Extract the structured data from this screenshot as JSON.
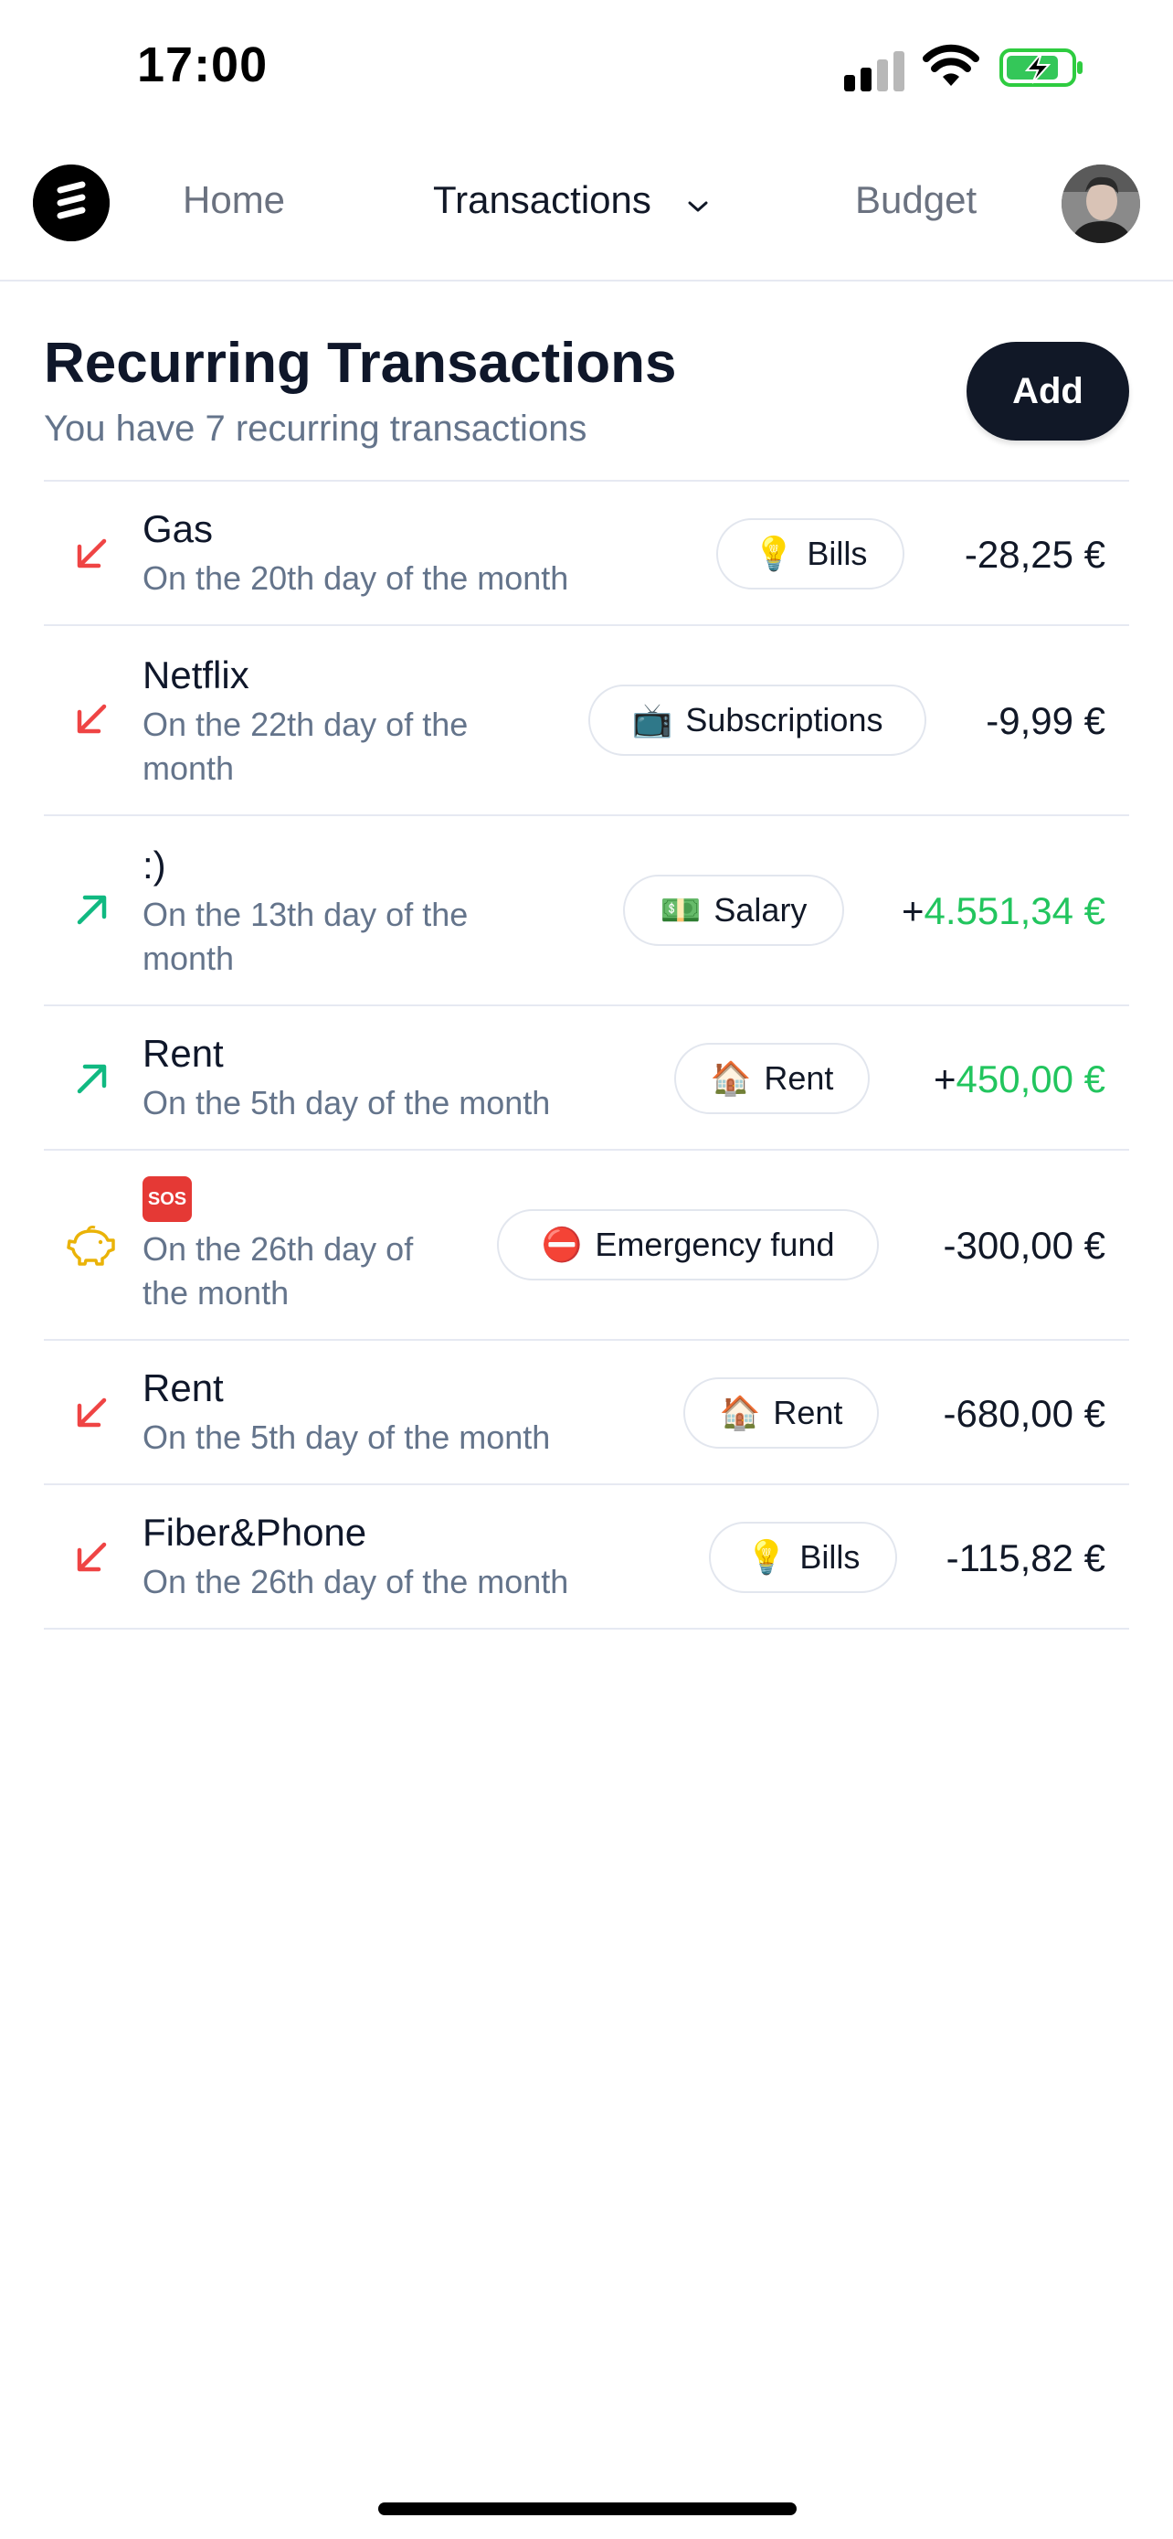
{
  "status_bar": {
    "time": "17:00"
  },
  "nav": {
    "home": "Home",
    "transactions": "Transactions",
    "budget": "Budget"
  },
  "header": {
    "title": "Recurring Transactions",
    "subtitle": "You have 7 recurring transactions",
    "add_label": "Add"
  },
  "colors": {
    "expense_arrow": "#ef4444",
    "income_arrow": "#10b981",
    "savings_icon": "#eab308",
    "positive_amount": "#22c55e",
    "button_bg": "#111827"
  },
  "transactions": [
    {
      "direction": "expense",
      "icon": "arrow-down-left-icon",
      "name": "Gas",
      "description": "On the 20th day of the month",
      "category_emoji": "💡",
      "category": "Bills",
      "amount": "-28,25 €"
    },
    {
      "direction": "expense",
      "icon": "arrow-down-left-icon",
      "name": "Netflix",
      "description": "On the 22th day of the month",
      "category_emoji": "📺",
      "category": "Subscriptions",
      "amount": "-9,99 €"
    },
    {
      "direction": "income",
      "icon": "arrow-up-right-icon",
      "name": ":)",
      "description": "On the 13th day of the month",
      "category_emoji": "💵",
      "category": "Salary",
      "amount_sign": "+",
      "amount_value": "4.551,34 €"
    },
    {
      "direction": "income",
      "icon": "arrow-up-right-icon",
      "name": "Rent",
      "description": "On the 5th day of the month",
      "category_emoji": "🏠",
      "category": "Rent",
      "amount_sign": "+",
      "amount_value": "450,00 €"
    },
    {
      "direction": "savings",
      "icon": "piggy-bank-icon",
      "name": "SOS",
      "description": "On the 26th day of the month",
      "category_emoji": "⛔",
      "category": "Emergency fund",
      "amount": "-300,00 €"
    },
    {
      "direction": "expense",
      "icon": "arrow-down-left-icon",
      "name": "Rent",
      "description": "On the 5th day of the month",
      "category_emoji": "🏠",
      "category": "Rent",
      "amount": "-680,00 €"
    },
    {
      "direction": "expense",
      "icon": "arrow-down-left-icon",
      "name": "Fiber&Phone",
      "description": "On the 26th day of the month",
      "category_emoji": "💡",
      "category": "Bills",
      "amount": "-115,82 €"
    }
  ]
}
